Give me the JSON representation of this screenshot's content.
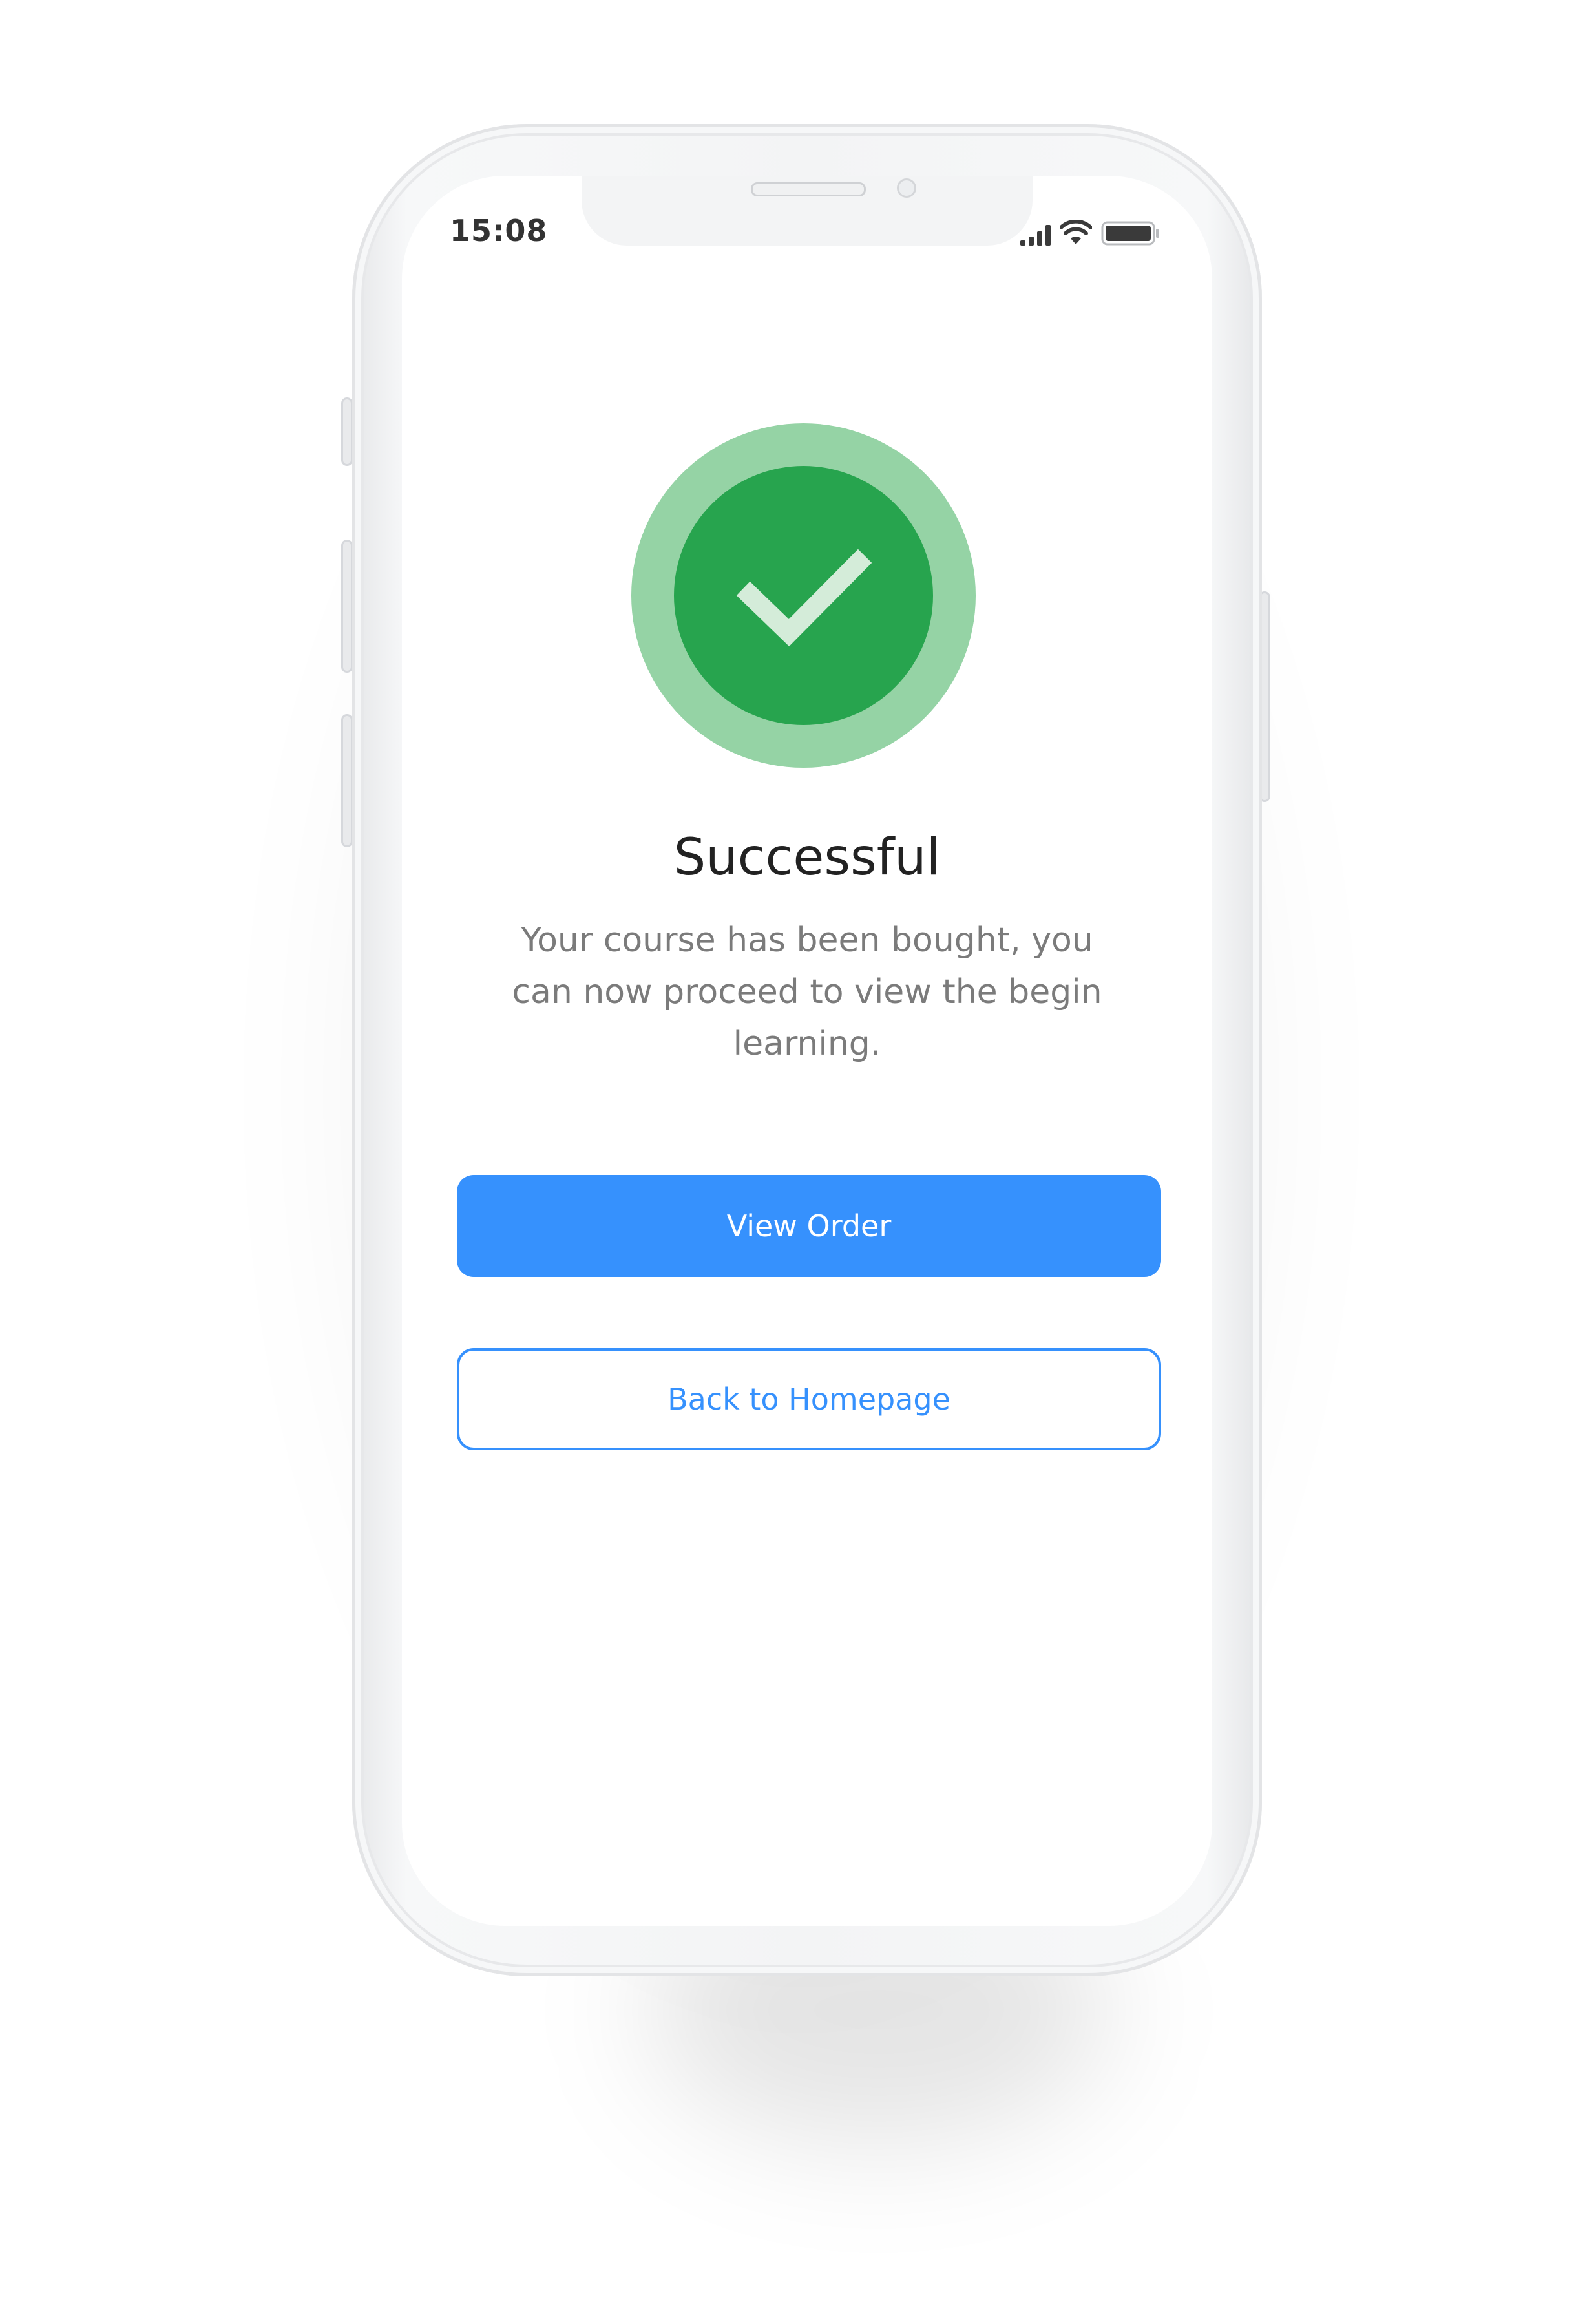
{
  "status_bar": {
    "time": "15:08",
    "icons": [
      "cellular-signal-icon",
      "wifi-icon",
      "battery-icon"
    ]
  },
  "success": {
    "icon": "checkmark-icon",
    "title": "Successful",
    "message": "Your course has been bought, you can now proceed to view the begin learning."
  },
  "actions": {
    "view_order_label": "View Order",
    "back_home_label": "Back to Homepage"
  },
  "colors": {
    "primary": "#3691fd",
    "success_dark": "#27a44e",
    "success_light": "#95d3a5",
    "title_text": "#222222",
    "body_text": "#7b7b7b"
  }
}
